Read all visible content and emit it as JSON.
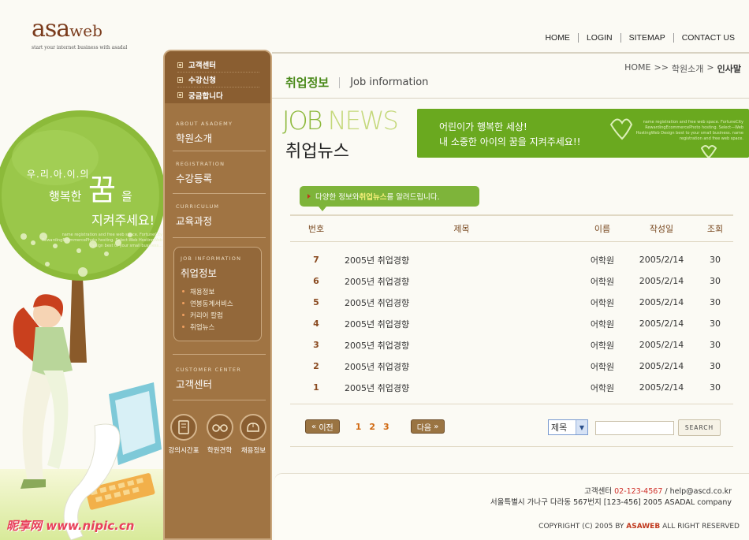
{
  "logo": {
    "main": "asa",
    "small": "web",
    "tagline": "start your internet business with asadal"
  },
  "topnav": {
    "items": [
      "HOME",
      "LOGIN",
      "SITEMAP",
      "CONTACT US"
    ]
  },
  "illustration": {
    "line1": "우.리.아.이.의",
    "big": "꿈",
    "line2a": "행복한",
    "line2b": "을",
    "line3": "지켜주세요!",
    "small_text": "name registration and free web space. FortuneCity RewardingEcommercePhoto hosting. Select-Web HostingWeb Design best to your small business..."
  },
  "watermark": "昵享网 www.nipic.cn",
  "sidebar": {
    "top_links": [
      "고객센터",
      "수강신청",
      "궁금합니다"
    ],
    "sections": [
      {
        "en": "ABOUT ASADEMY",
        "ko": "학원소개"
      },
      {
        "en": "REGISTRATION",
        "ko": "수강등록"
      },
      {
        "en": "CURRICULUM",
        "ko": "교육과정"
      },
      {
        "en": "CUSTOMER CENTER",
        "ko": "고객센터"
      }
    ],
    "active_section": {
      "en": "JOB INFORMATION",
      "ko": "취업정보",
      "items": [
        "채용정보",
        "연봉동계서비스",
        "커리어 칼럼",
        "취업뉴스"
      ]
    },
    "quick_links": [
      "강의시간표",
      "학원견학",
      "채용정보"
    ]
  },
  "breadcrumb": {
    "items": [
      "HOME",
      ">>",
      "학원소개",
      ">"
    ],
    "current": "인사말"
  },
  "page_title": {
    "ko": "취업정보",
    "en": "Job information"
  },
  "headline": {
    "job": "JOB",
    "news": "NEWS",
    "ko": "취업뉴스"
  },
  "banner": {
    "line1": "어린이가 행복한 세상!",
    "line2": "내 소중한 아이의 꿈을 지켜주세요!!",
    "small_text": "name registration and free web space. FortuneCity RewardingEcommercePhoto hosting. Select—Web HostingWeb Design best to your small business. name registration and free web space."
  },
  "info_tag": {
    "pre": "다양한 정보와 ",
    "highlight": "취업뉴스",
    "post": "를 알려드립니다."
  },
  "table": {
    "headers": [
      "번호",
      "제목",
      "이름",
      "작성일",
      "조회"
    ],
    "rows": [
      [
        "7",
        "2005년 취업경향",
        "어학원",
        "2005/2/14",
        "30"
      ],
      [
        "6",
        "2005년 취업경향",
        "어학원",
        "2005/2/14",
        "30"
      ],
      [
        "5",
        "2005년 취업경향",
        "어학원",
        "2005/2/14",
        "30"
      ],
      [
        "4",
        "2005년 취업경향",
        "어학원",
        "2005/2/14",
        "30"
      ],
      [
        "3",
        "2005년 취업경향",
        "어학원",
        "2005/2/14",
        "30"
      ],
      [
        "2",
        "2005년 취업경향",
        "어학원",
        "2005/2/14",
        "30"
      ],
      [
        "1",
        "2005년 취업경향",
        "어학원",
        "2005/2/14",
        "30"
      ]
    ]
  },
  "pager": {
    "prev": "이전",
    "pages": [
      "1",
      "2",
      "3"
    ],
    "next": "다음"
  },
  "search": {
    "field": "제목",
    "value": "",
    "button": "SEARCH"
  },
  "footer": {
    "center_label": "고객센터",
    "tel": "02-123-4567",
    "email": " / help@ascd.co.kr",
    "address": "서울특별시 가나구 다라동 567번지 [123-456] 2005 ASADAL company",
    "copyright_pre": "COPYRIGHT (C) 2005 BY ",
    "brand": "ASAWEB",
    "copyright_post": " ALL RIGHT RESERVED"
  },
  "colors": {
    "brown": "#a07443",
    "green": "#6aa91f",
    "accent_red": "#d0302a",
    "orange": "#d06810"
  }
}
